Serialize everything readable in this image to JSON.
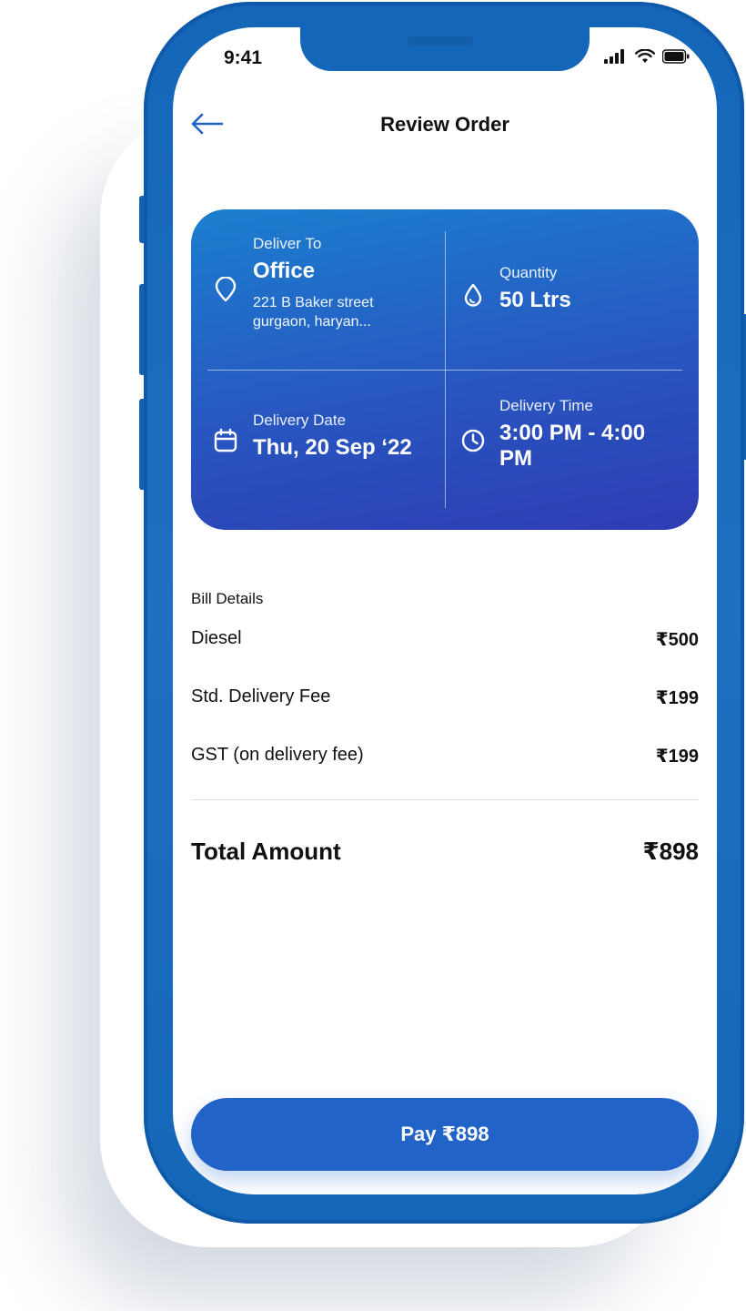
{
  "status_bar": {
    "time": "9:41"
  },
  "header": {
    "title": "Review Order"
  },
  "order_card": {
    "deliver_to": {
      "label": "Deliver To",
      "value": "Office",
      "address_line1": "221 B Baker street",
      "address_line2": "gurgaon, haryan..."
    },
    "quantity": {
      "label": "Quantity",
      "value": "50 Ltrs"
    },
    "delivery_date": {
      "label": "Delivery Date",
      "value": "Thu, 20 Sep ‘22"
    },
    "delivery_time": {
      "label": "Delivery Time",
      "value_line1": "3:00 PM - 4:00",
      "value_line2": "PM"
    }
  },
  "bill": {
    "title": "Bill Details",
    "items": [
      {
        "label": "Diesel",
        "amount": "₹500"
      },
      {
        "label": "Std. Delivery Fee",
        "amount": "₹199"
      },
      {
        "label": "GST (on delivery fee)",
        "amount": "₹199"
      }
    ],
    "total_label": "Total Amount",
    "total_amount": "₹898"
  },
  "pay_button": {
    "label": "Pay ₹898"
  },
  "colors": {
    "accent": "#2263c7",
    "frame": "#1466b8",
    "card_top": "#1b7fcf",
    "card_bottom": "#2e3cb3"
  }
}
